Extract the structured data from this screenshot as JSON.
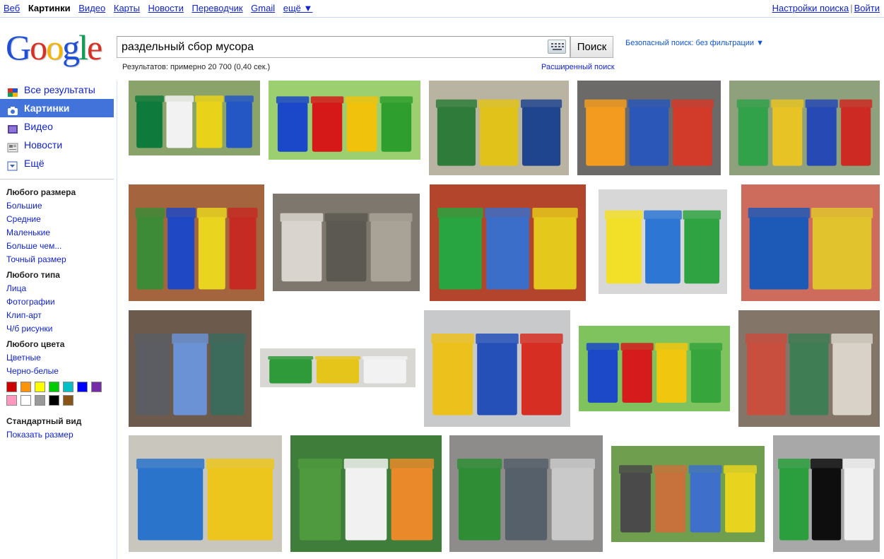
{
  "topbar": {
    "nav": [
      {
        "label": "Веб",
        "current": false
      },
      {
        "label": "Картинки",
        "current": true
      },
      {
        "label": "Видео",
        "current": false
      },
      {
        "label": "Карты",
        "current": false
      },
      {
        "label": "Новости",
        "current": false
      },
      {
        "label": "Переводчик",
        "current": false
      },
      {
        "label": "Gmail",
        "current": false
      }
    ],
    "more_label": "ещё ▼",
    "settings_label": "Настройки поиска",
    "separator": "|",
    "signin_label": "Войти"
  },
  "logo": {
    "letters": [
      "G",
      "o",
      "o",
      "g",
      "l",
      "e"
    ],
    "colors": [
      "#1d4fd8",
      "#d93025",
      "#f4b400",
      "#1d4fd8",
      "#0f9d58",
      "#d93025"
    ]
  },
  "search": {
    "query": "раздельный сбор мусора",
    "button_label": "Поиск",
    "safe_search": "Безопасный поиск: без фильтрации ▼",
    "stats": "Результатов: примерно 20 700 (0,40 сек.)",
    "advanced": "Расширенный поиск"
  },
  "sidebar": {
    "modes": [
      {
        "label": "Все результаты",
        "icon": "google-multicolor-icon",
        "selected": false
      },
      {
        "label": "Картинки",
        "icon": "camera-icon",
        "selected": true
      },
      {
        "label": "Видео",
        "icon": "film-icon",
        "selected": false
      },
      {
        "label": "Новости",
        "icon": "newspaper-icon",
        "selected": false
      },
      {
        "label": "Ещё",
        "icon": "dropdown-icon",
        "selected": false
      }
    ],
    "size": {
      "heading": "Любого размера",
      "items": [
        "Большие",
        "Средние",
        "Маленькие",
        "Больше чем...",
        "Точный размер"
      ]
    },
    "type": {
      "heading": "Любого типа",
      "items": [
        "Лица",
        "Фотографии",
        "Клип-арт",
        "Ч/б рисунки"
      ]
    },
    "color": {
      "heading": "Любого цвета",
      "items": [
        "Цветные",
        "Черно-белые"
      ],
      "swatches": [
        "#cc0000",
        "#fb940b",
        "#ffff00",
        "#00cc00",
        "#03c0c6",
        "#0000ff",
        "#762ca7",
        "#ff98bf",
        "#ffffff",
        "#999999",
        "#000000",
        "#885418"
      ]
    },
    "view": {
      "heading": "Стандартный вид",
      "items": [
        "Показать размер"
      ]
    }
  },
  "results": [
    {
      "name": "image-result-colored-bins-yard",
      "bg": "#8aa36a",
      "items": [
        "#0e7a3b",
        "#f2f2f2",
        "#e8d21a",
        "#2457c4"
      ]
    },
    {
      "name": "image-result-four-recycle-bins",
      "bg": "#9ccf6f",
      "items": [
        "#1b47c9",
        "#d51919",
        "#f0c20c",
        "#2e9e2e"
      ]
    },
    {
      "name": "image-result-metal-glass-plastic-bins",
      "bg": "#b9b3a1",
      "items": [
        "#2e7b3a",
        "#e1c21b",
        "#20458f"
      ]
    },
    {
      "name": "image-result-round-plastic-bin",
      "bg": "#6b6a68",
      "items": [
        "#f29b1f",
        "#2a57b8",
        "#d23a2a"
      ]
    },
    {
      "name": "image-result-jug-bins",
      "bg": "#8ea07c",
      "items": [
        "#31a14a",
        "#e7c326",
        "#2749b4",
        "#cc2a22"
      ]
    },
    {
      "name": "image-result-bins-street",
      "bg": "#a4653e",
      "items": [
        "#3d8a37",
        "#1f48c5",
        "#e9d420",
        "#c52b23"
      ]
    },
    {
      "name": "image-result-garbage-pile",
      "bg": "#7d776e",
      "items": [
        "#d9d5ce",
        "#5c5952",
        "#a8a297"
      ]
    },
    {
      "name": "image-result-greenpeace-bin-mascot",
      "bg": "#b2452c",
      "items": [
        "#28a540",
        "#3b6ec9",
        "#e4c81b"
      ]
    },
    {
      "name": "image-result-plastic-paper-glass",
      "bg": "#d7d7d7",
      "items": [
        "#f2df28",
        "#2d76d4",
        "#2fa342"
      ]
    },
    {
      "name": "image-result-containers-wall",
      "bg": "#cd6b5c",
      "items": [
        "#1d59b7",
        "#e1c42d"
      ]
    },
    {
      "name": "image-result-grey-blue-wheelie-bins",
      "bg": "#6c5a4d",
      "items": [
        "#5b5d62",
        "#6a92d4",
        "#3c6b5c"
      ]
    },
    {
      "name": "image-result-garbage-trucks",
      "bg": "#d9d7d3",
      "items": [
        "#2f9a3a",
        "#e5c51a",
        "#f2f2f2"
      ]
    },
    {
      "name": "image-result-sorting-lid",
      "bg": "#c7c9cb",
      "items": [
        "#ecc11c",
        "#2550b8",
        "#d62e23"
      ]
    },
    {
      "name": "image-result-four-bins-green",
      "bg": "#7ec35d",
      "items": [
        "#1c49c8",
        "#d51b1b",
        "#f1c60e",
        "#35a53c"
      ]
    },
    {
      "name": "image-result-dump-yard",
      "bg": "#837669",
      "items": [
        "#c84e3e",
        "#3f7d55",
        "#d8d2c8"
      ]
    },
    {
      "name": "image-result-blue-yellow-containers",
      "bg": "#c9c7bd",
      "items": [
        "#2a74cc",
        "#ecc61d"
      ]
    },
    {
      "name": "image-result-wwf-green-bins",
      "bg": "#3f7e3a",
      "items": [
        "#4f9a3f",
        "#f1f1f1",
        "#e9892a"
      ]
    },
    {
      "name": "image-result-police-bin",
      "bg": "#8e8c8a",
      "items": [
        "#2f8d36",
        "#56606a",
        "#c9c9c9"
      ]
    },
    {
      "name": "image-result-park-bins",
      "bg": "#6e9e4e",
      "items": [
        "#4a4a4a",
        "#c7723d",
        "#3e6fcb",
        "#e8d31e"
      ]
    },
    {
      "name": "image-result-greenpeace-costume",
      "bg": "#a8a8a8",
      "items": [
        "#2b9e3d",
        "#0e0e0e",
        "#f0f0f0"
      ]
    }
  ]
}
